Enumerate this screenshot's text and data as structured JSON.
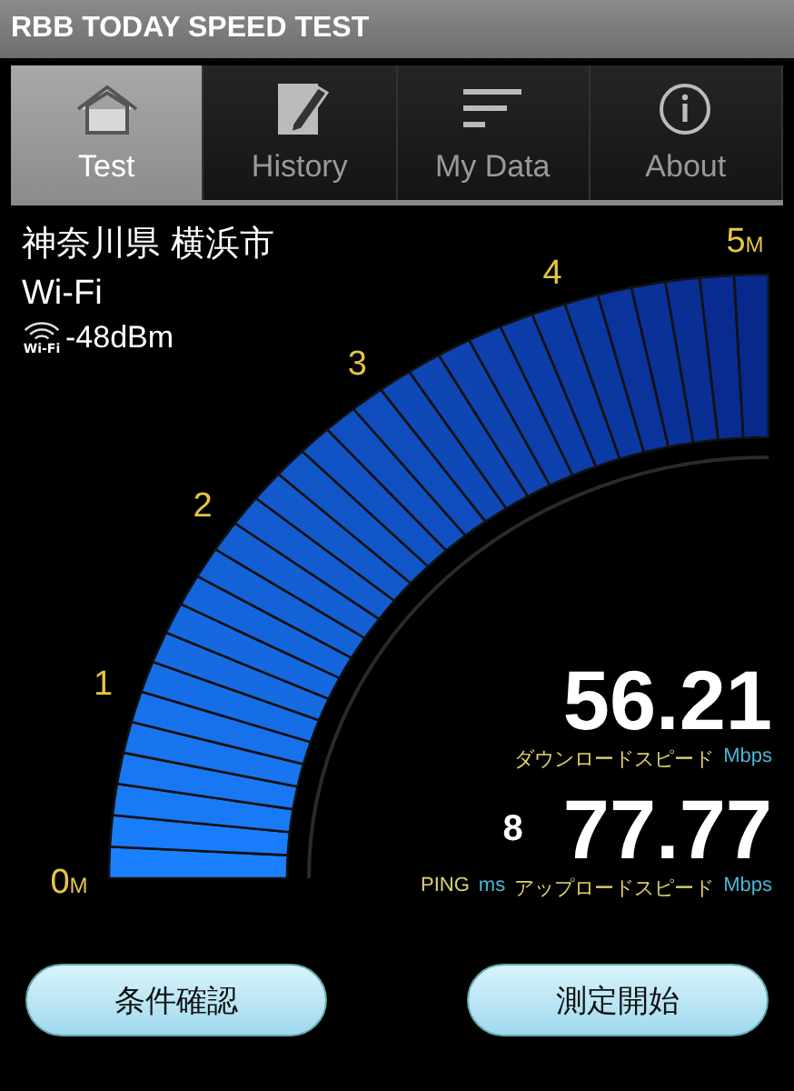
{
  "window": {
    "title": "RBB TODAY SPEED TEST"
  },
  "tabs": [
    {
      "label": "Test",
      "kind": "home",
      "selected": true
    },
    {
      "label": "History",
      "kind": "edit",
      "selected": false
    },
    {
      "label": "My Data",
      "kind": "lines",
      "selected": false
    },
    {
      "label": "About",
      "kind": "info",
      "selected": false
    }
  ],
  "connection": {
    "location": "神奈川県 横浜市",
    "network": "Wi-Fi",
    "wifi_badge": "Wi-Fi",
    "signal": "-48dBm"
  },
  "gauge": {
    "scale": [
      {
        "value": "0",
        "unit": "M"
      },
      {
        "value": "1"
      },
      {
        "value": "2"
      },
      {
        "value": "3"
      },
      {
        "value": "4"
      },
      {
        "value": "5",
        "unit": "M"
      }
    ]
  },
  "download": {
    "value": "56.21",
    "label": "ダウンロードスピード",
    "unit": "Mbps"
  },
  "ping": {
    "value": "8",
    "label": "PING",
    "unit": "ms"
  },
  "upload": {
    "value": "77.77",
    "label": "アップロードスピード",
    "unit": "Mbps"
  },
  "buttons": [
    "条件確認",
    "測定開始"
  ]
}
